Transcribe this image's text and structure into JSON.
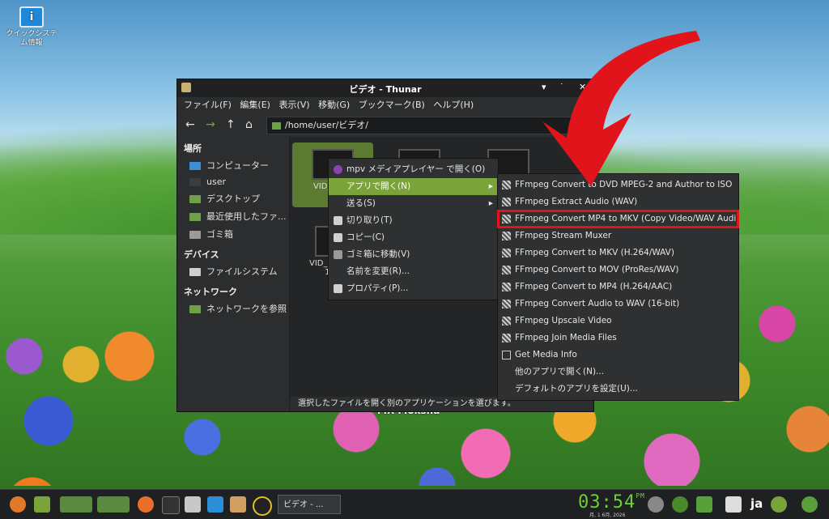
{
  "desktop": {
    "icon_label": "クイックシステム情報",
    "icon_glyph": "i",
    "watermark": "MX Moksha"
  },
  "window": {
    "title": "ビデオ - Thunar",
    "buttons": {
      "menu": "▾",
      "minimize": "˙",
      "close": "✕"
    },
    "menu": [
      "ファイル(F)",
      "編集(E)",
      "表示(V)",
      "移動(G)",
      "ブックマーク(B)",
      "ヘルプ(H)"
    ],
    "nav": {
      "back": "←",
      "forward": "→",
      "up": "↑",
      "home": "⌂"
    },
    "path": "/home/user/ビデオ/",
    "sidebar": {
      "places_header": "場所",
      "places": [
        {
          "label": "コンピューター",
          "color": "#3d8fd6"
        },
        {
          "label": "user",
          "color": "#3a3c3d"
        },
        {
          "label": "デスクトップ",
          "color": "#6ea04a"
        },
        {
          "label": "最近使用したファ...",
          "color": "#6ea04a"
        },
        {
          "label": "ゴミ箱",
          "color": "#9a9a9a"
        }
      ],
      "devices_header": "デバイス",
      "devices": [
        {
          "label": "ファイルシステム",
          "color": "#cfcfcf"
        }
      ],
      "network_header": "ネットワーク",
      "network": [
        {
          "label": "ネットワークを参照",
          "color": "#6ea04a"
        }
      ]
    },
    "files": [
      {
        "name": "VID_2025"
      },
      {
        "name": "7."
      },
      {
        "name": "VID_2025"
      },
      {
        "name": "1."
      }
    ],
    "status": "選択したファイルを開く別のアプリケーションを選びます。"
  },
  "context_menu": [
    {
      "label": "mpv メディアプレイヤー で開く(O)",
      "icon": "mpv-icon",
      "color": "#8e44ad"
    },
    {
      "label": "アプリで開く(N)",
      "highlight": true,
      "submenu": "▸"
    },
    {
      "label": "送る(S)",
      "submenu": "▸"
    },
    {
      "label": "切り取り(T)",
      "icon": "scissors-icon",
      "color": "#d0d0d0"
    },
    {
      "label": "コピー(C)",
      "icon": "copy-icon",
      "color": "#d0d0d0"
    },
    {
      "label": "ゴミ箱に移動(V)",
      "icon": "trash-icon",
      "color": "#9a9a9a"
    },
    {
      "label": "名前を変更(R)..."
    },
    {
      "label": "プロパティ(P)...",
      "icon": "properties-icon",
      "color": "#d0d0d0"
    }
  ],
  "submenu": [
    {
      "label": "FFmpeg Convert to DVD MPEG-2 and Author to ISO",
      "icon": true
    },
    {
      "label": "FFmpeg Extract Audio (WAV)",
      "icon": true
    },
    {
      "label": "FFmpeg Convert MP4 to MKV (Copy Video/WAV Audio)",
      "icon": true,
      "boxed": true
    },
    {
      "label": "FFmpeg Stream Muxer",
      "icon": true
    },
    {
      "label": "FFmpeg Convert to MKV (H.264/WAV)",
      "icon": true
    },
    {
      "label": "FFmpeg Convert to MOV (ProRes/WAV)",
      "icon": true
    },
    {
      "label": "FFmpeg Convert to MP4 (H.264/AAC)",
      "icon": true
    },
    {
      "label": "FFmpeg Convert Audio to WAV (16-bit)",
      "icon": true
    },
    {
      "label": "FFmpeg Upscale Video",
      "icon": true
    },
    {
      "label": "FFmpeg Join Media Files",
      "icon": true
    },
    {
      "label": "Get Media Info",
      "icon": "info"
    },
    {
      "label": "他のアプリで開く(N)..."
    },
    {
      "label": "デフォルトのアプリを設定(U)..."
    }
  ],
  "taskbar": {
    "task_label": "ビデオ - ...",
    "time": "03:54",
    "ampm": "PM",
    "date": "月, 1 6月, 2026",
    "lang": "ja"
  },
  "colors": {
    "highlight": "#7aa33a",
    "annotation": "#e0141a",
    "clock": "#6fcf3a"
  }
}
